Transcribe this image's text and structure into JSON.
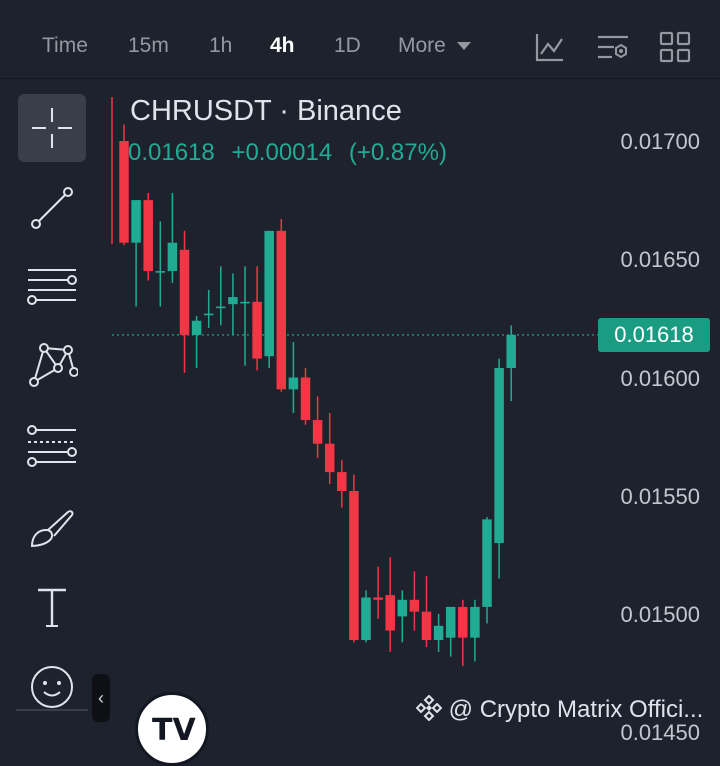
{
  "timeframes": [
    {
      "label": "Time",
      "active": false
    },
    {
      "label": "15m",
      "active": false
    },
    {
      "label": "1h",
      "active": false
    },
    {
      "label": "4h",
      "active": true
    },
    {
      "label": "1D",
      "active": false
    },
    {
      "label": "More",
      "active": false
    }
  ],
  "header_icons": [
    "indicators-icon",
    "chart-settings-icon",
    "layout-grid-icon"
  ],
  "tools": [
    "crosshair-icon",
    "trend-line-icon",
    "horizontal-lines-icon",
    "pattern-icon",
    "fib-levels-icon",
    "brush-icon",
    "text-icon",
    "emoji-icon"
  ],
  "symbol": {
    "name": "CHRUSDT · Binance",
    "price": "0.01618",
    "change": "+0.00014",
    "change_pct": "(+0.87%)"
  },
  "price_axis": [
    "0.01700",
    "0.01650",
    "0.01600",
    "0.01550",
    "0.01500",
    "0.01450"
  ],
  "last_price_label": "0.01618",
  "watermark": "@ Crypto Matrix Offici...",
  "logo_text": "TV",
  "colors": {
    "up": "#22ab94",
    "down": "#f23645",
    "background": "#1e222d"
  },
  "chart_data": {
    "type": "candlestick",
    "y_unit": "USDT",
    "candles": [
      {
        "o": 0.017,
        "h": 0.01707,
        "l": 0.01656,
        "c": 0.01657
      },
      {
        "o": 0.01657,
        "h": 0.01675,
        "l": 0.0163,
        "c": 0.01675
      },
      {
        "o": 0.01675,
        "h": 0.01678,
        "l": 0.01641,
        "c": 0.01645
      },
      {
        "o": 0.01645,
        "h": 0.01666,
        "l": 0.0163,
        "c": 0.01645
      },
      {
        "o": 0.01645,
        "h": 0.01678,
        "l": 0.0164,
        "c": 0.01657
      },
      {
        "o": 0.01654,
        "h": 0.01662,
        "l": 0.01602,
        "c": 0.01618
      },
      {
        "o": 0.01618,
        "h": 0.01626,
        "l": 0.01604,
        "c": 0.01624
      },
      {
        "o": 0.01627,
        "h": 0.01637,
        "l": 0.01621,
        "c": 0.01627
      },
      {
        "o": 0.0163,
        "h": 0.01647,
        "l": 0.01622,
        "c": 0.0163
      },
      {
        "o": 0.01631,
        "h": 0.01644,
        "l": 0.01618,
        "c": 0.01634
      },
      {
        "o": 0.01632,
        "h": 0.01647,
        "l": 0.01605,
        "c": 0.01632
      },
      {
        "o": 0.01632,
        "h": 0.01647,
        "l": 0.01603,
        "c": 0.01608
      },
      {
        "o": 0.01609,
        "h": 0.01662,
        "l": 0.01604,
        "c": 0.01662
      },
      {
        "o": 0.01662,
        "h": 0.01667,
        "l": 0.01594,
        "c": 0.01595
      },
      {
        "o": 0.01595,
        "h": 0.01615,
        "l": 0.01585,
        "c": 0.016
      },
      {
        "o": 0.016,
        "h": 0.01604,
        "l": 0.0158,
        "c": 0.01582
      },
      {
        "o": 0.01582,
        "h": 0.01592,
        "l": 0.01566,
        "c": 0.01572
      },
      {
        "o": 0.01572,
        "h": 0.01585,
        "l": 0.01555,
        "c": 0.0156
      },
      {
        "o": 0.0156,
        "h": 0.01565,
        "l": 0.01545,
        "c": 0.01552
      },
      {
        "o": 0.01552,
        "h": 0.01559,
        "l": 0.01488,
        "c": 0.01489
      },
      {
        "o": 0.01489,
        "h": 0.0151,
        "l": 0.01488,
        "c": 0.01507
      },
      {
        "o": 0.01507,
        "h": 0.0152,
        "l": 0.01498,
        "c": 0.01506
      },
      {
        "o": 0.01508,
        "h": 0.01524,
        "l": 0.01484,
        "c": 0.01493
      },
      {
        "o": 0.01499,
        "h": 0.0151,
        "l": 0.01488,
        "c": 0.01506
      },
      {
        "o": 0.01506,
        "h": 0.01518,
        "l": 0.01493,
        "c": 0.01501
      },
      {
        "o": 0.01501,
        "h": 0.01516,
        "l": 0.01486,
        "c": 0.01489
      },
      {
        "o": 0.01489,
        "h": 0.015,
        "l": 0.01484,
        "c": 0.01495
      },
      {
        "o": 0.0149,
        "h": 0.01503,
        "l": 0.01482,
        "c": 0.01503
      },
      {
        "o": 0.01503,
        "h": 0.01506,
        "l": 0.01478,
        "c": 0.0149
      },
      {
        "o": 0.0149,
        "h": 0.01506,
        "l": 0.0148,
        "c": 0.01503
      },
      {
        "o": 0.01503,
        "h": 0.01541,
        "l": 0.01496,
        "c": 0.0154
      },
      {
        "o": 0.0153,
        "h": 0.01608,
        "l": 0.01515,
        "c": 0.01604
      },
      {
        "o": 0.01604,
        "h": 0.01622,
        "l": 0.0159,
        "c": 0.01618
      }
    ],
    "last_price": 0.01618,
    "ylim": [
      0.0145,
      0.0172
    ]
  }
}
